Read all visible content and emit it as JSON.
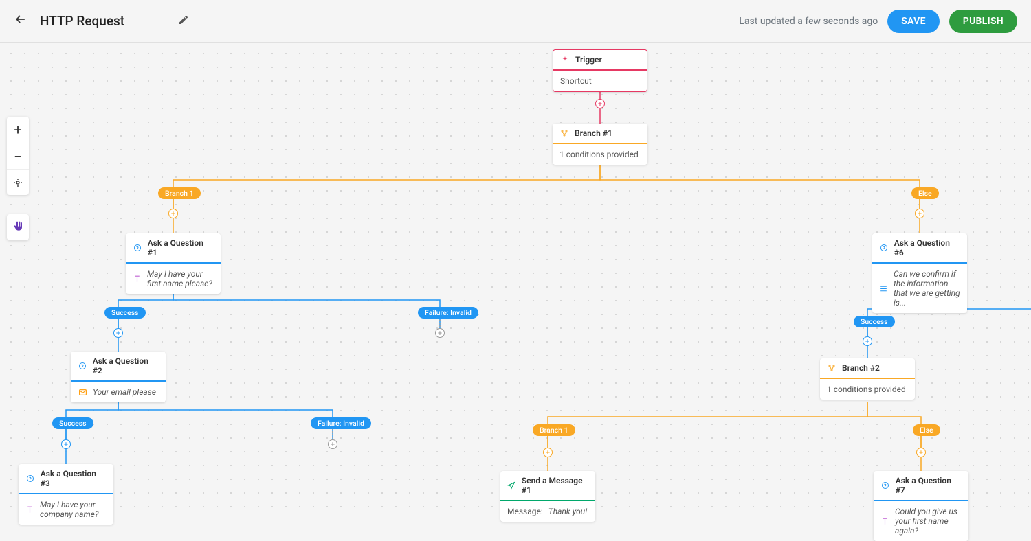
{
  "header": {
    "title": "HTTP Request",
    "last_updated": "Last updated a few seconds ago",
    "save_label": "SAVE",
    "publish_label": "PUBLISH"
  },
  "nodes": {
    "trigger": {
      "title": "Trigger",
      "body": "Shortcut"
    },
    "branch1": {
      "title": "Branch #1",
      "body": "1 conditions provided"
    },
    "branch2": {
      "title": "Branch #2",
      "body": "1 conditions provided"
    },
    "q1": {
      "title": "Ask a Question #1",
      "body": "May I have your first name please?"
    },
    "q2": {
      "title": "Ask a Question #2",
      "body": "Your email please"
    },
    "q3": {
      "title": "Ask a Question #3",
      "body": "May I have your company name?"
    },
    "q6": {
      "title": "Ask a Question #6",
      "body": "Can we confirm if the information that we are getting is..."
    },
    "q7": {
      "title": "Ask a Question #7",
      "body": "Could you give us your first name again?"
    },
    "msg1": {
      "title": "Send a Message #1",
      "body_label": "Message:",
      "body_value": "Thank you!"
    }
  },
  "pills": {
    "branch1_label": "Branch 1",
    "else_label": "Else",
    "success": "Success",
    "failure_invalid": "Failure: Invalid"
  },
  "colors": {
    "pink": "#e63963",
    "orange": "#f9a825",
    "blue": "#2196f3",
    "green": "#00a86b",
    "purple": "#673ab7"
  }
}
